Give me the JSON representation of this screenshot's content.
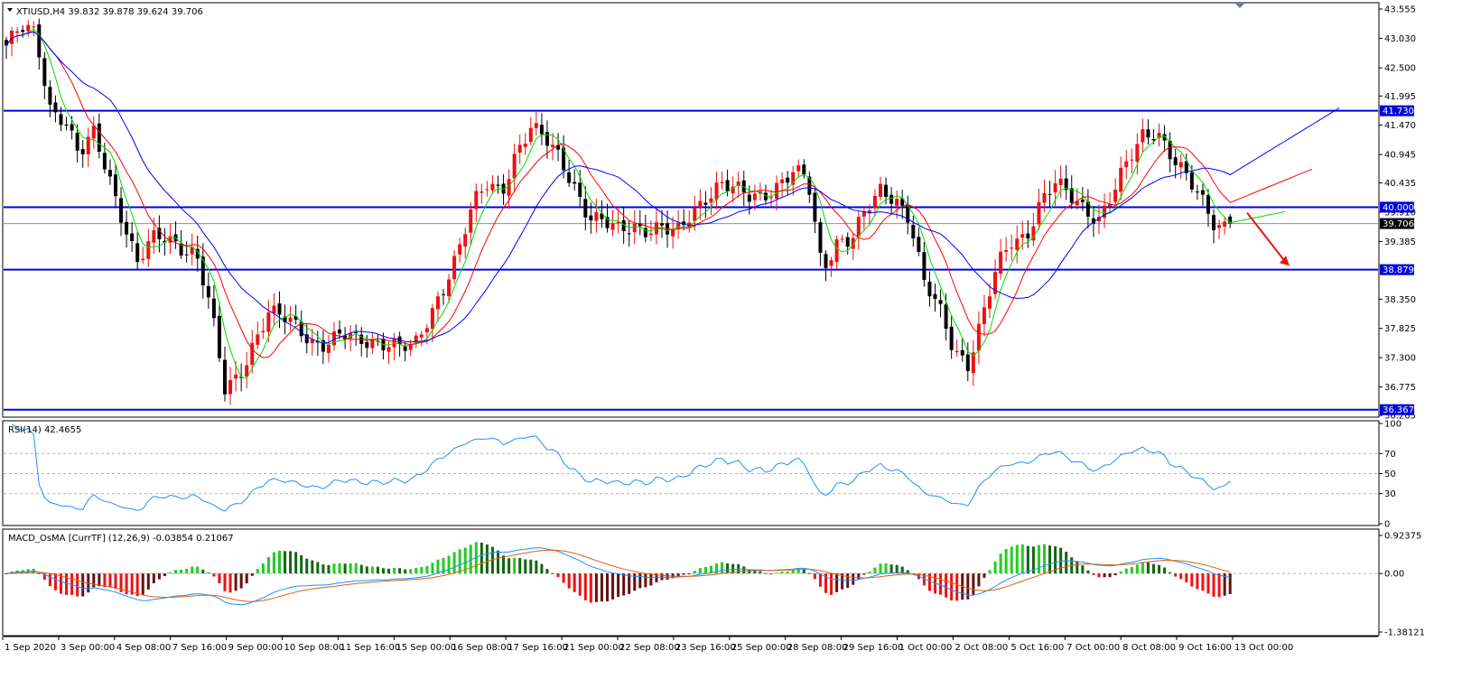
{
  "chart_data": {
    "type": "candlestick",
    "platform_symbol": "XTIUSD",
    "timeframe": "H4",
    "header": "XTIUSD,H4  39.832 39.878 39.624 39.706",
    "ohlc": {
      "open": 39.832,
      "high": 39.878,
      "low": 39.624,
      "close": 39.706
    },
    "price_ticks": [
      "43.555",
      "43.030",
      "42.500",
      "41.995",
      "41.470",
      "40.945",
      "40.435",
      "39.910",
      "39.385",
      "38.350",
      "37.825",
      "37.300",
      "36.775",
      "36.265"
    ],
    "price_range": [
      36.265,
      43.62
    ],
    "levels": [
      {
        "label": "41.730",
        "value": 41.73
      },
      {
        "label": "40.000",
        "value": 40.0
      },
      {
        "label": "38.879",
        "value": 38.879
      },
      {
        "label": "36.367",
        "value": 36.367
      }
    ],
    "current_price_label": "39.706",
    "current_price": 39.706,
    "date_labels": [
      "1 Sep 2020",
      "3 Sep 00:00",
      "4 Sep 08:00",
      "7 Sep 16:00",
      "9 Sep 00:00",
      "10 Sep 08:00",
      "11 Sep 16:00",
      "15 Sep 00:00",
      "16 Sep 08:00",
      "17 Sep 16:00",
      "21 Sep 00:00",
      "22 Sep 08:00",
      "23 Sep 16:00",
      "25 Sep 00:00",
      "28 Sep 08:00",
      "29 Sep 16:00",
      "1 Oct 00:00",
      "2 Oct 08:00",
      "5 Oct 16:00",
      "7 Oct 00:00",
      "8 Oct 08:00",
      "9 Oct 16:00",
      "13 Oct 00:00"
    ],
    "close_path": [
      42.9,
      43.2,
      43.1,
      41.8,
      41.6,
      40.9,
      41.3,
      40.6,
      39.8,
      39.0,
      39.4,
      39.45,
      39.3,
      39.2,
      38.2,
      36.7,
      37.0,
      37.6,
      38.1,
      38.0,
      37.85,
      37.6,
      37.55,
      37.7,
      37.6,
      37.6,
      37.6,
      37.5,
      37.45,
      38.0,
      38.6,
      39.2,
      40.0,
      40.4,
      40.3,
      41.0,
      41.4,
      41.2,
      40.9,
      40.4,
      39.8,
      39.7,
      39.6,
      39.7,
      39.6,
      39.6,
      39.5,
      39.9,
      40.2,
      40.4,
      40.3,
      40.2,
      40.25,
      40.4,
      40.6,
      40.5,
      38.9,
      39.4,
      39.4,
      39.9,
      40.3,
      40.2,
      39.8,
      38.6,
      38.2,
      37.5,
      37.2,
      38.0,
      38.9,
      39.4,
      39.5,
      40.1,
      40.4,
      40.2,
      40.0,
      39.8,
      40.25,
      40.8,
      41.3,
      41.4,
      40.9,
      40.5,
      40.15,
      39.7,
      39.706
    ],
    "ma_periods": [
      5,
      10,
      20
    ],
    "ma_colors": {
      "fast": "#00dd00",
      "mid": "#ff0000",
      "slow": "#0000ff"
    },
    "forecast_arrow": {
      "direction": "down",
      "from": 39.9,
      "to": 38.95,
      "color": "#ee1111"
    },
    "bull_color": "#ee1111",
    "bear_color": "#000000",
    "rsi": {
      "label": "RSI(14) 42.4655",
      "period": 14,
      "value": 42.4655,
      "ticks": [
        "100",
        "70",
        "50",
        "30",
        "0"
      ],
      "levels": [
        70,
        50,
        30
      ],
      "color": "#1e90ff"
    },
    "macd": {
      "label": "MACD_OsMA [CurrTF] (12,26,9) -0.03854 0.21067",
      "params": [
        12,
        26,
        9
      ],
      "values": [
        -0.03854,
        0.21067
      ],
      "ticks": [
        "0.92375",
        "0.00",
        "-1.38121"
      ],
      "range": [
        -1.45,
        1.0
      ],
      "line_color": "#1e90ff",
      "signal_color": "#e06010",
      "hist_up_colors": [
        "#22cc22",
        "#116611"
      ],
      "hist_down_colors": [
        "#ee1111",
        "#661111"
      ]
    }
  }
}
